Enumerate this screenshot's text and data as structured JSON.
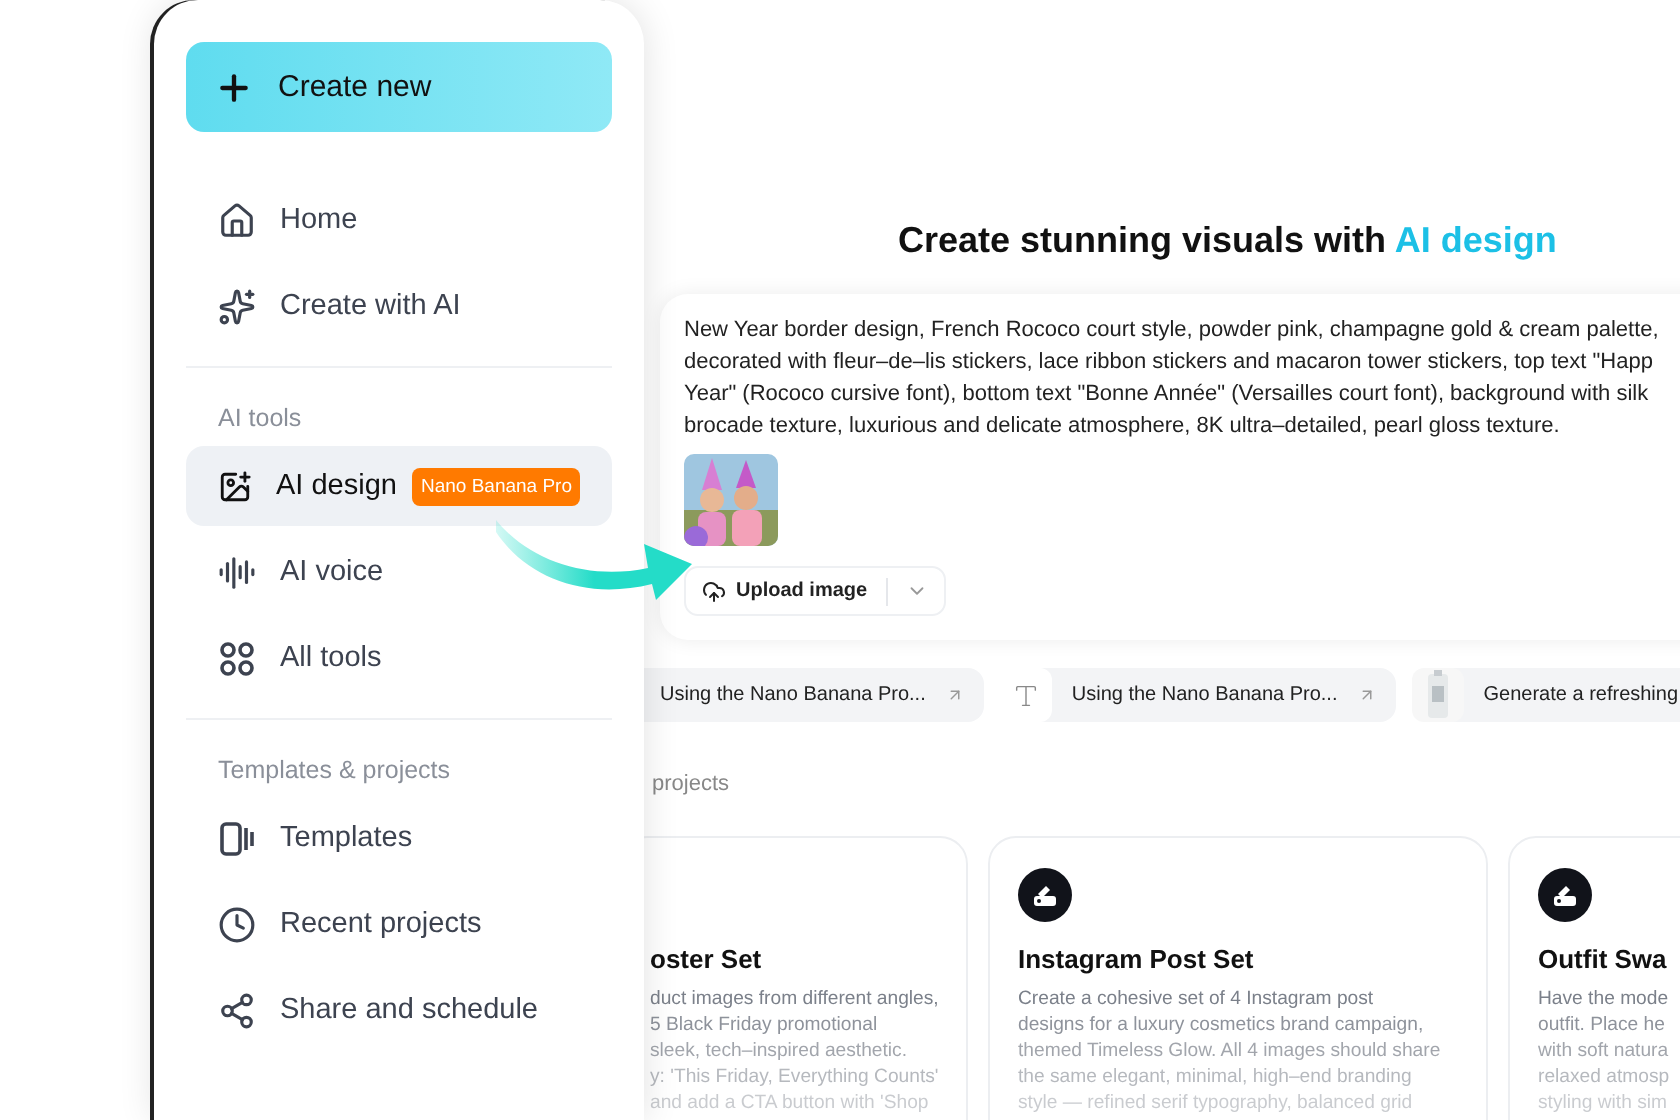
{
  "sidebar": {
    "create_button": "Create new",
    "groups": [
      {
        "items": [
          {
            "label": "Home",
            "selected": false
          },
          {
            "label": "Create with AI",
            "selected": false
          }
        ]
      },
      {
        "heading": "AI tools",
        "items": [
          {
            "label": "AI design",
            "selected": true,
            "badge": "Nano Banana Pro"
          },
          {
            "label": "AI voice",
            "selected": false
          },
          {
            "label": "All tools",
            "selected": false
          }
        ]
      },
      {
        "heading": "Templates & projects",
        "items": [
          {
            "label": "Templates",
            "selected": false
          },
          {
            "label": "Recent projects",
            "selected": false
          },
          {
            "label": "Share and schedule",
            "selected": false
          }
        ]
      }
    ]
  },
  "main": {
    "heading": {
      "text": "Create stunning visuals with",
      "highlight": "AI design"
    },
    "prompt": {
      "lines": [
        "New Year border design, French Rococo court style, powder pink, champagne gold & cream palette,",
        "decorated with fleur–de–lis stickers, lace ribbon stickers and macaron tower stickers, top text \"Happ",
        "Year\" (Rococo cursive font), bottom text \"Bonne Année\" (Versailles court font), background with silk",
        "brocade texture, luxurious and delicate atmosphere, 8K ultra–detailed, pearl gloss texture."
      ],
      "upload_button": "Upload image"
    },
    "suggestions": [
      {
        "label": "Using the Nano Banana Pro...",
        "kind": "none"
      },
      {
        "label": "Using the Nano Banana Pro...",
        "kind": "text"
      },
      {
        "label": "Generate a refreshing",
        "kind": "picture"
      }
    ],
    "section_title": "projects",
    "cards": [
      {
        "title": "oster Set",
        "has_icon": false,
        "lines": [
          "duct images from different angles,",
          "5 Black Friday promotional",
          "sleek, tech–inspired aesthetic.",
          "y: 'This Friday, Everything Counts'",
          "and add a CTA button with 'Shop"
        ]
      },
      {
        "title": "Instagram Post Set",
        "has_icon": true,
        "lines": [
          "Create a cohesive set of 4 Instagram post",
          "designs for a luxury cosmetics brand campaign,",
          "themed Timeless Glow. All 4 images should share",
          "the same elegant, minimal, high–end branding",
          "style — refined serif typography, balanced grid"
        ]
      },
      {
        "title": "Outfit Swa",
        "has_icon": true,
        "lines": [
          "Have the mode",
          "outfit. Place he",
          "with soft natura",
          "relaxed atmosp",
          "styling with sim"
        ]
      }
    ]
  }
}
